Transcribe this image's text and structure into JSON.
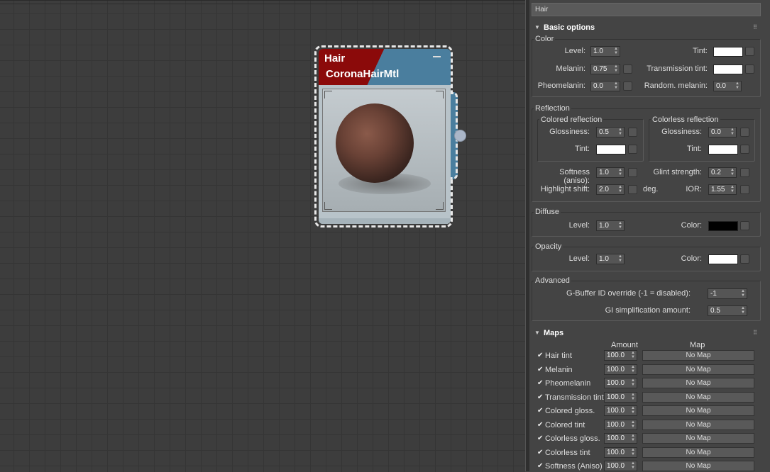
{
  "material_name": "Hair",
  "node": {
    "title": "Hair",
    "type": "CoronaHairMtl"
  },
  "basic_options": {
    "title": "Basic options",
    "color_group": {
      "title": "Color",
      "level_label": "Level:",
      "level": "1.0",
      "tint_label": "Tint:",
      "tint_color": "#ffffff",
      "melanin_label": "Melanin:",
      "melanin": "0.75",
      "transmission_tint_label": "Transmission tint:",
      "transmission_tint_color": "#ffffff",
      "pheomelanin_label": "Pheomelanin:",
      "pheomelanin": "0.0",
      "random_melanin_label": "Random. melanin:",
      "random_melanin": "0.0"
    },
    "reflection_group": {
      "title": "Reflection",
      "colored": {
        "title": "Colored reflection",
        "glossiness_label": "Glossiness:",
        "glossiness": "0.5",
        "tint_label": "Tint:",
        "tint_color": "#ffffff"
      },
      "colorless": {
        "title": "Colorless reflection",
        "glossiness_label": "Glossiness:",
        "glossiness": "0.0",
        "tint_label": "Tint:",
        "tint_color": "#ffffff"
      },
      "softness_label": "Softness (aniso):",
      "softness": "1.0",
      "glint_label": "Glint strength:",
      "glint": "0.2",
      "highlight_label": "Highlight shift:",
      "highlight": "2.0",
      "deg_label": "deg.",
      "ior_label": "IOR:",
      "ior": "1.55"
    },
    "diffuse_group": {
      "title": "Diffuse",
      "level_label": "Level:",
      "level": "1.0",
      "color_label": "Color:",
      "color": "#000000"
    },
    "opacity_group": {
      "title": "Opacity",
      "level_label": "Level:",
      "level": "1.0",
      "color_label": "Color:",
      "color": "#ffffff"
    },
    "advanced_group": {
      "title": "Advanced",
      "gbuffer_label": "G-Buffer ID override (-1 = disabled):",
      "gbuffer": "-1",
      "gi_label": "GI simplification amount:",
      "gi": "0.5"
    }
  },
  "maps": {
    "title": "Maps",
    "amount_header": "Amount",
    "map_header": "Map",
    "rows": [
      {
        "label": "Hair tint",
        "amount": "100.0",
        "map": "No Map",
        "checked": "✔"
      },
      {
        "label": "Melanin",
        "amount": "100.0",
        "map": "No Map",
        "checked": "✔"
      },
      {
        "label": "Pheomelanin",
        "amount": "100.0",
        "map": "No Map",
        "checked": "✔"
      },
      {
        "label": "Transmission tint",
        "amount": "100.0",
        "map": "No Map",
        "checked": "✔"
      },
      {
        "label": "Colored gloss.",
        "amount": "100.0",
        "map": "No Map",
        "checked": "✔"
      },
      {
        "label": "Colored tint",
        "amount": "100.0",
        "map": "No Map",
        "checked": "✔"
      },
      {
        "label": "Colorless gloss.",
        "amount": "100.0",
        "map": "No Map",
        "checked": "✔"
      },
      {
        "label": "Colorless tint",
        "amount": "100.0",
        "map": "No Map",
        "checked": "✔"
      },
      {
        "label": "Softness (Aniso)",
        "amount": "100.0",
        "map": "No Map",
        "checked": "✔"
      }
    ]
  }
}
